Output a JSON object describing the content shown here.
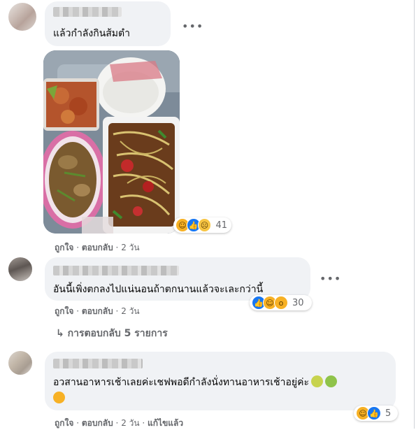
{
  "comments": [
    {
      "text": "แล้วกำลังกินส้มตำ",
      "reactions": {
        "icons": [
          "haha-icon",
          "like-icon",
          "sad-icon"
        ],
        "count": "41"
      },
      "actions": {
        "like": "ถูกใจ",
        "reply": "ตอบกลับ",
        "time": "2 วัน"
      }
    },
    {
      "text": "อันนี้เพิ่งตกลงไปแน่นอนถ้าตกนานแล้วจะเละกว่านี้",
      "reactions": {
        "icons": [
          "like-icon",
          "haha-icon",
          "wow-icon"
        ],
        "count": "30"
      },
      "actions": {
        "like": "ถูกใจ",
        "reply": "ตอบกลับ",
        "time": "2 วัน"
      },
      "replies_link": "การตอบกลับ 5 รายการ"
    },
    {
      "text": "อวสานอาหารเช้าเลยค่ะเชฟพอดีกำลังนั่งทานอาหารเช้าอยู่ค่ะ",
      "reactions": {
        "icons": [
          "haha-icon",
          "like-icon"
        ],
        "count": "5"
      },
      "actions": {
        "like": "ถูกใจ",
        "reply": "ตอบกลับ",
        "time": "2 วัน",
        "edited": "แก้ไขแล้ว"
      }
    }
  ],
  "colors": {
    "bubble": "#f0f2f5",
    "meta": "#65676b",
    "like_blue": "#1877f2",
    "haha": "#f7b125"
  }
}
